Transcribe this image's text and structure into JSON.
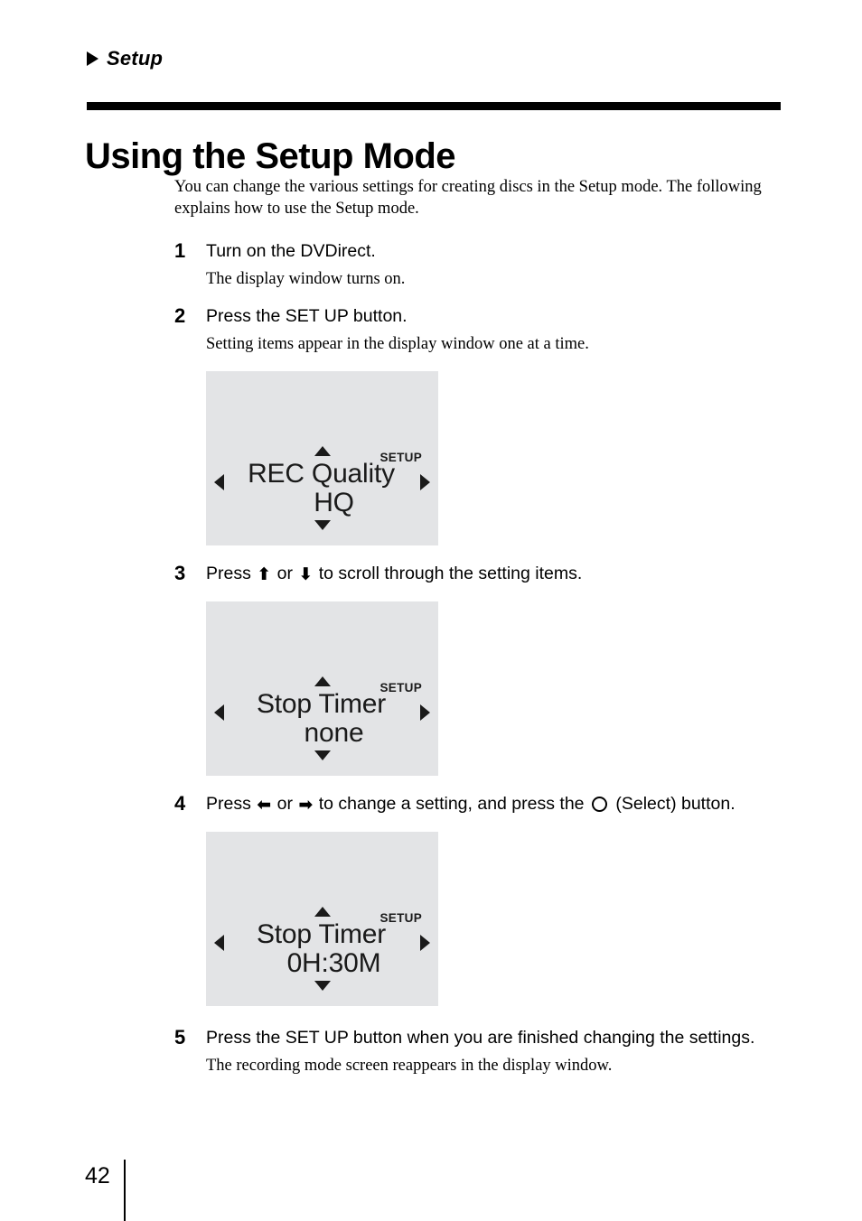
{
  "running_head": {
    "marker_icon": "triangle-right-icon",
    "label": "Setup"
  },
  "title": "Using the Setup Mode",
  "intro": "You can change the various settings for creating discs in the Setup mode. The following explains how to use the Setup mode.",
  "steps": [
    {
      "number": "1",
      "heading": "Turn on the DVDirect.",
      "sub": "The display window turns on."
    },
    {
      "number": "2",
      "heading": "Press the SET UP button.",
      "sub": "Setting items appear in the display window one at a time."
    },
    {
      "number": "3",
      "heading_before": "Press",
      "arrow_up": "⬆",
      "heading_mid": "or",
      "arrow_down": "⬇",
      "heading_after": "to scroll through the setting items.",
      "sub": ""
    },
    {
      "number": "4",
      "heading_before": "Press",
      "arrow_left": "⬅",
      "heading_mid": "or",
      "arrow_right": "➡",
      "heading_after": "to change a setting, and press the",
      "select_label": "(Select) button.",
      "sub": ""
    },
    {
      "number": "5",
      "heading": "Press the SET UP button when you are finished changing the settings.",
      "sub": "The recording mode screen reappears in the display window."
    }
  ],
  "displays": [
    {
      "setup_label": "SETUP",
      "line1": "REC Quality",
      "line2": "HQ",
      "background": "#e3e4e6"
    },
    {
      "setup_label": "SETUP",
      "line1": "Stop Timer",
      "line2": "none",
      "background": "#e3e4e6"
    },
    {
      "setup_label": "SETUP",
      "line1": "Stop Timer",
      "line2": "0H:30M",
      "background": "#e3e4e6"
    }
  ],
  "folio": "42"
}
